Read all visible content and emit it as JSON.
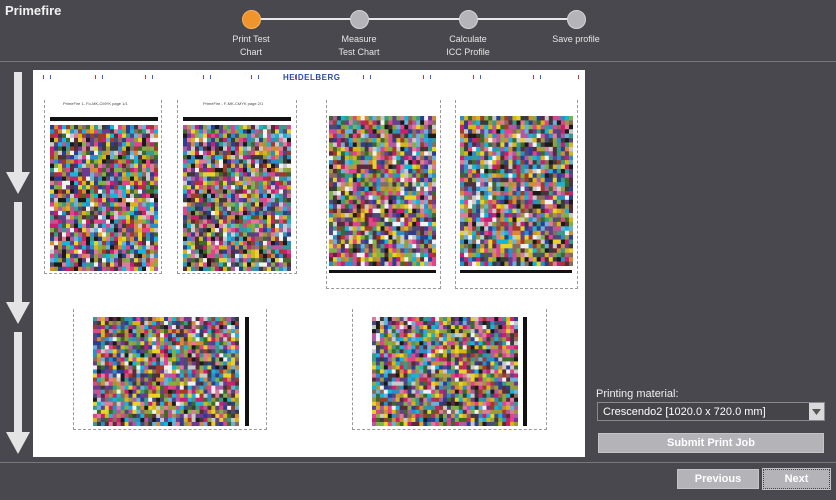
{
  "app": {
    "title": "Primefire"
  },
  "wizard": {
    "steps": [
      {
        "label": "Print Test\nChart",
        "active": true
      },
      {
        "label": "Measure\nTest Chart",
        "active": false
      },
      {
        "label": "Calculate\nICC Profile",
        "active": false
      },
      {
        "label": "Save profile",
        "active": false
      }
    ]
  },
  "preview": {
    "logo": "HEIDELBERG",
    "captions": [
      "PrimeFire 1- Fo-MK-CMYK page 1/1",
      "PrimeFire - F-MK-CMYK page 2/1"
    ]
  },
  "panel": {
    "printing_material_label": "Printing material:",
    "printing_material_value": "Crescendo2 [1020.0 x 720.0 mm]",
    "submit_label": "Submit Print Job"
  },
  "nav": {
    "previous_label": "Previous",
    "next_label": "Next"
  },
  "colors": {
    "accent": "#f0952b",
    "background": "#48484e",
    "button": "#b4b4b8"
  }
}
